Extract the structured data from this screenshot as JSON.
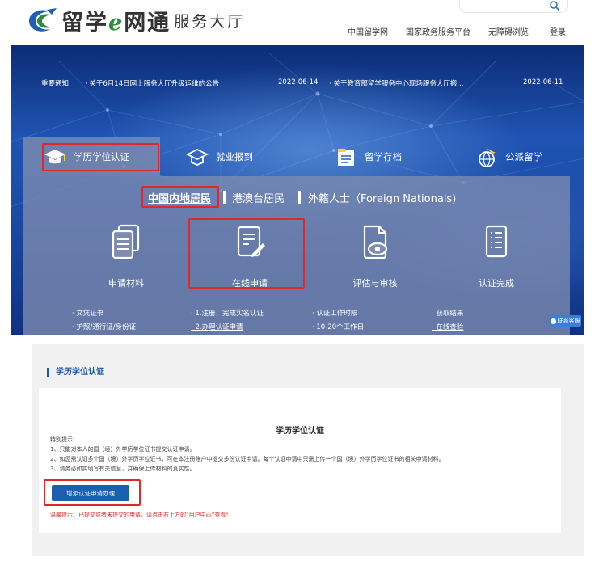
{
  "header": {
    "logo_title_part1": "留学",
    "logo_title_e": "e",
    "logo_title_part2": "网通",
    "logo_subtitle": "服务大厅",
    "nav": [
      "中国留学网",
      "国家政务服务平台",
      "无障碍浏览",
      "登录"
    ]
  },
  "notices": {
    "label": "重要通知",
    "items": [
      {
        "text": "· 关于6月14日网上服务大厅升级运维的公告",
        "date": "2022-06-14"
      },
      {
        "text": "· 关于教育部留学服务中心现场服务大厅搬...",
        "date": "2022-06-11"
      }
    ]
  },
  "tabs": [
    "学历学位认证",
    "就业报到",
    "留学存档",
    "公派留学"
  ],
  "categories": [
    "中国内地居民",
    "港澳台居民",
    "外籍人士（Foreign Nationals)"
  ],
  "steps": [
    {
      "label": "申请材料",
      "bullets": [
        "· 文凭证书",
        "· 护照/通行证/身份证"
      ]
    },
    {
      "label": "在线申请",
      "bullets": [
        "· 1.注册，完成实名认证",
        "· 2.办理认证申请"
      ]
    },
    {
      "label": "评估与审核",
      "bullets": [
        "· 认证工作时限",
        "· 10-20个工作日"
      ]
    },
    {
      "label": "认证完成",
      "bullets": [
        "· 获取结果",
        "· 在线查验"
      ]
    }
  ],
  "help_label": "联系客服",
  "section": {
    "title": "学历学位认证",
    "card_title": "学历学位认证",
    "tips_heading": "特别提示：",
    "tips": [
      "1、只能对本人的国（境）外学历学位证书提交认证申请。",
      "2、如您需认证多个国（境）外学历学位证书，可在本注册账户中提交多份认证申请。每个认证申请中只需上传一个国（境）外学历学位证书的相关申请材料。",
      "3、请务必如实填写有关信息，并确保上传材料的真实性。"
    ],
    "apply_button": "增添认证申请办理",
    "reminder": "温馨提示：已提交或者未提交的申请，请点击右上方的“用户中心”查看！"
  },
  "colors": {
    "accent_red": "#e02828",
    "primary_blue": "#1b5fae",
    "banner_blue": "#1f54b4",
    "logo_green": "#2e8b3a"
  }
}
